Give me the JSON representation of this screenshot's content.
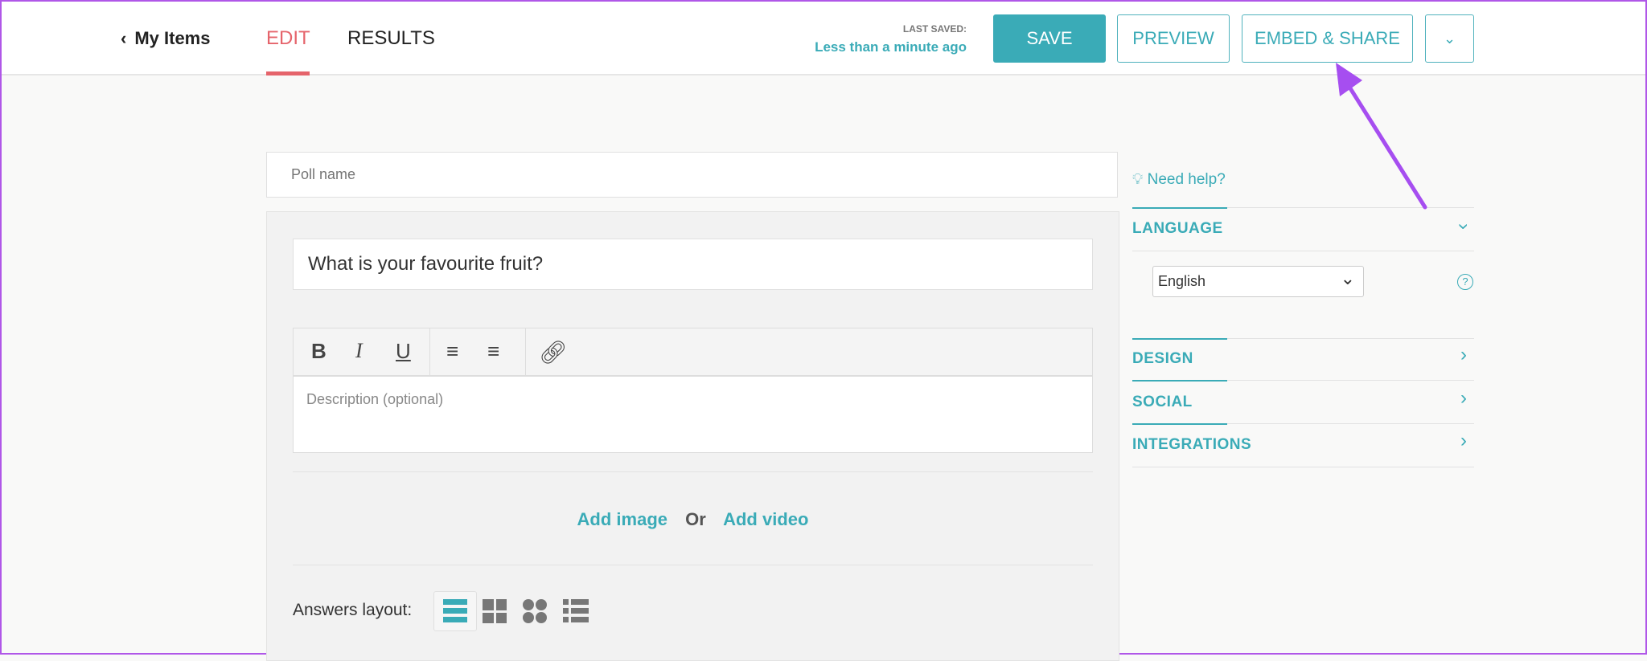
{
  "header": {
    "back_label": "My Items",
    "tabs": [
      {
        "label": "EDIT",
        "active": true
      },
      {
        "label": "RESULTS",
        "active": false
      }
    ],
    "last_saved_label": "LAST SAVED:",
    "last_saved_value": "Less than a minute ago",
    "save_label": "SAVE",
    "preview_label": "PREVIEW",
    "embed_label": "EMBED & SHARE"
  },
  "editor": {
    "poll_name_placeholder": "Poll name",
    "question_value": "What is your favourite fruit?",
    "toolbar": {
      "bold": "B",
      "italic": "I",
      "underline": "U"
    },
    "description_placeholder": "Description (optional)",
    "add_image": "Add image",
    "or": "Or",
    "add_video": "Add video",
    "answers_layout_label": "Answers layout:"
  },
  "sidebar": {
    "help": "Need help?",
    "sections": [
      {
        "label": "LANGUAGE",
        "expanded": true
      },
      {
        "label": "DESIGN",
        "expanded": false
      },
      {
        "label": "SOCIAL",
        "expanded": false
      },
      {
        "label": "INTEGRATIONS",
        "expanded": false
      }
    ],
    "language_value": "English"
  },
  "colors": {
    "accent": "#3aabb7",
    "active_tab": "#e5646b",
    "annotation_arrow": "#a64ef0"
  }
}
